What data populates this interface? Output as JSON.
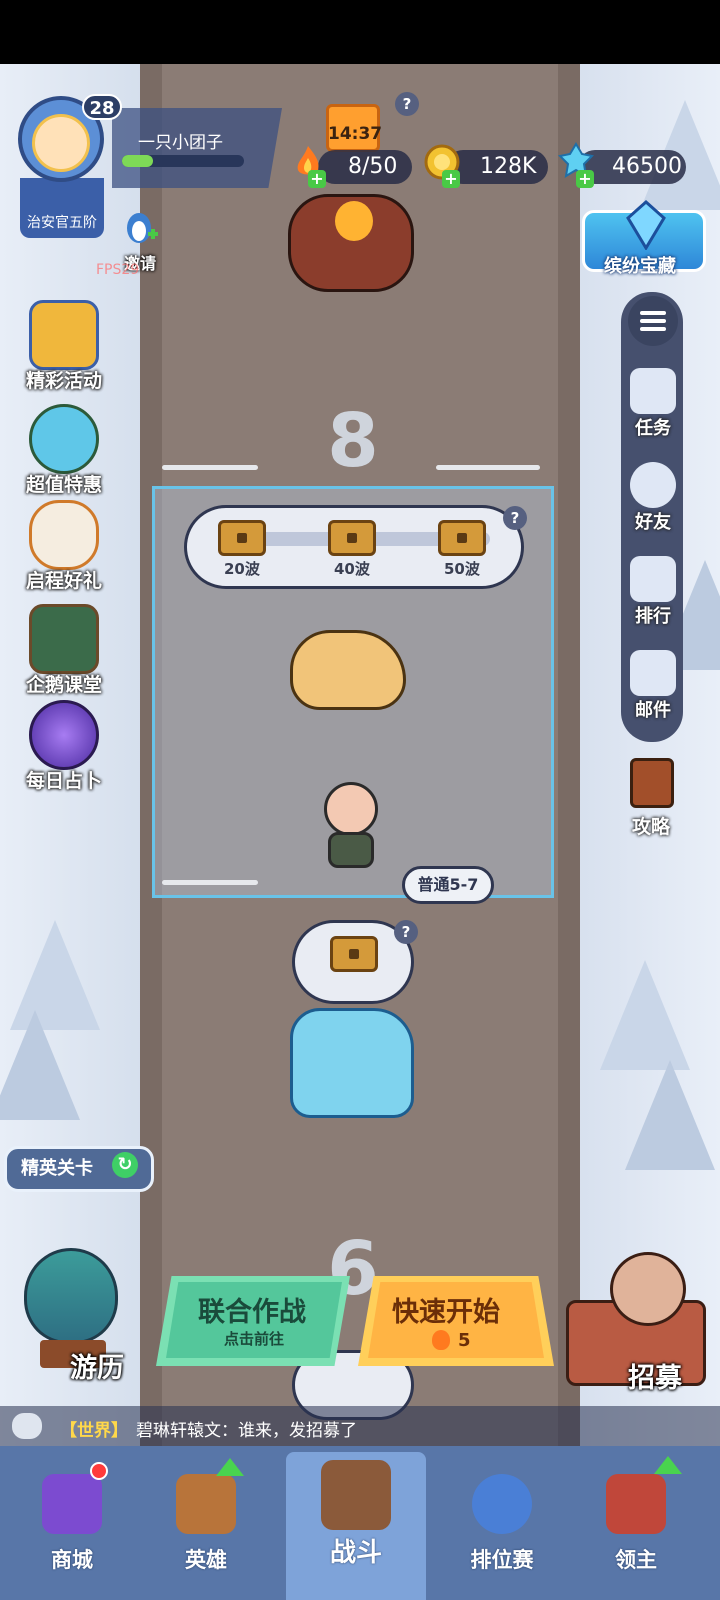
{
  "player": {
    "level": "28",
    "name": "一只小团子",
    "rank": "治安官五阶",
    "xp_fraction": 0.25,
    "invite_label": "邀请",
    "fps_text": "FPS29"
  },
  "resources": {
    "timer": "14:37",
    "energy": "8/50",
    "gold": "128K",
    "gems": "46500"
  },
  "left_menu": [
    {
      "label": "精彩活动",
      "icon": "gold-chest-icon"
    },
    {
      "label": "超值特惠",
      "icon": "clock-icon"
    },
    {
      "label": "启程好礼",
      "icon": "griffin-icon"
    },
    {
      "label": "企鹅课堂",
      "icon": "penguin-teacher-icon"
    },
    {
      "label": "每日占卜",
      "icon": "crystal-ball-icon"
    }
  ],
  "right_menu": {
    "treasure_label": "缤纷宝藏",
    "items": [
      {
        "label": "任务",
        "icon": "task-clipboard-icon"
      },
      {
        "label": "好友",
        "icon": "friends-icon"
      },
      {
        "label": "排行",
        "icon": "ranking-podium-icon"
      },
      {
        "label": "邮件",
        "icon": "mail-icon"
      }
    ],
    "guide_label": "攻略"
  },
  "stage": {
    "current_number": "8",
    "next_number": "6",
    "waves": [
      "20波",
      "40波",
      "50波"
    ],
    "difficulty_label": "普通5-7"
  },
  "buttons": {
    "elite_label": "精英关卡",
    "travel_label": "游历",
    "coop_title": "联合作战",
    "coop_sub": "点击前往",
    "quick_title": "快速开始",
    "quick_cost": "5",
    "recruit_label": "招募"
  },
  "chat": {
    "channel": "【世界】",
    "message": "碧琳轩辕文：谁来，发招募了"
  },
  "nav": [
    {
      "label": "商城",
      "icon": "shop-icon",
      "active": false
    },
    {
      "label": "英雄",
      "icon": "hero-card-icon",
      "active": false
    },
    {
      "label": "战斗",
      "icon": "crossed-swords-icon",
      "active": true
    },
    {
      "label": "排位赛",
      "icon": "rank-shield-icon",
      "active": false
    },
    {
      "label": "领主",
      "icon": "lord-banner-icon",
      "active": false
    }
  ],
  "colors": {
    "road": "#8b7c75",
    "snow": "#dfe6f1",
    "nav_bg": "#5876a8",
    "coop_green": "#54c79b",
    "quick_orange": "#ffb444",
    "stage_border": "#69c3e8"
  }
}
